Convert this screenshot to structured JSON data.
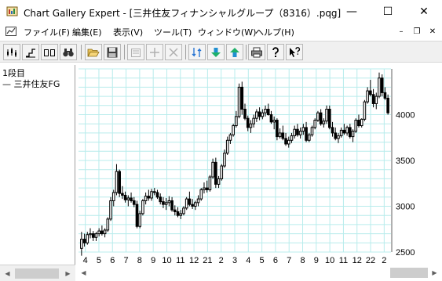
{
  "window": {
    "title": "Chart Gallery Expert - [三井住友フィナンシャルグループ（8316）.pqg]",
    "minimize_glyph": "—",
    "maximize_glyph": "☐",
    "close_glyph": "✕"
  },
  "menu": {
    "items": [
      "ファイル(F)",
      "編集(E)",
      "表示(V)",
      "ツール(T)",
      "ウィンドウ(W)",
      "ヘルプ(H)"
    ],
    "mdi_minimize_glyph": "–",
    "mdi_restore_glyph": "❐",
    "mdi_close_glyph": "✕"
  },
  "toolbar": {
    "buttons": [
      {
        "name": "candlestick-chart-button",
        "icon": "candlestick-icon",
        "enabled": true
      },
      {
        "name": "step-chart-button",
        "icon": "step-chart-icon",
        "enabled": true
      },
      {
        "name": "two-pane-button",
        "icon": "two-pane-icon",
        "enabled": true
      },
      {
        "name": "find-button",
        "icon": "binoculars-icon",
        "enabled": true
      },
      {
        "name": "open-button",
        "icon": "folder-open-icon",
        "enabled": true
      },
      {
        "name": "save-button",
        "icon": "floppy-disk-icon",
        "enabled": true
      },
      {
        "name": "properties-button",
        "icon": "properties-icon",
        "enabled": false
      },
      {
        "name": "add-button",
        "icon": "plus-icon",
        "enabled": false
      },
      {
        "name": "delete-button",
        "icon": "x-icon",
        "enabled": false
      },
      {
        "name": "sort-button",
        "icon": "sort-icon",
        "enabled": true
      },
      {
        "name": "move-down-button",
        "icon": "arrow-down-icon",
        "enabled": true
      },
      {
        "name": "move-up-button",
        "icon": "arrow-up-icon",
        "enabled": true
      },
      {
        "name": "print-button",
        "icon": "printer-icon",
        "enabled": true
      },
      {
        "name": "help-button",
        "icon": "help-question-icon",
        "enabled": true
      },
      {
        "name": "context-help-button",
        "icon": "context-help-icon",
        "enabled": true
      }
    ]
  },
  "legend": {
    "row_label": "1段目",
    "series_label": "— 三井住友FG"
  },
  "colors": {
    "grid": "#b8ecec",
    "candle": "#000000",
    "scroll_bg": "#f0f0f0"
  },
  "chart_data": {
    "type": "candlestick",
    "title": "",
    "series_name": "三井住友FG",
    "ylim": [
      2500,
      4500
    ],
    "y_ticks": [
      2500,
      3000,
      3500,
      4000
    ],
    "y_tick_labels": [
      "2500",
      "3000",
      "3500",
      "4000"
    ],
    "x_tick_labels": [
      "4",
      "5",
      "6",
      "7",
      "8",
      "9",
      "10",
      "11",
      "12",
      "21",
      "2",
      "3",
      "4",
      "5",
      "6",
      "7",
      "8",
      "9",
      "10",
      "11",
      "12",
      "22",
      "2"
    ],
    "grid": true,
    "candles": [
      [
        2540,
        2720,
        2460,
        2640
      ],
      [
        2640,
        2700,
        2560,
        2600
      ],
      [
        2600,
        2720,
        2580,
        2690
      ],
      [
        2690,
        2760,
        2650,
        2700
      ],
      [
        2700,
        2730,
        2620,
        2660
      ],
      [
        2660,
        2720,
        2620,
        2700
      ],
      [
        2700,
        2760,
        2670,
        2730
      ],
      [
        2730,
        2790,
        2680,
        2700
      ],
      [
        2700,
        2760,
        2660,
        2740
      ],
      [
        2740,
        2880,
        2720,
        2860
      ],
      [
        2860,
        3100,
        2840,
        3060
      ],
      [
        3060,
        3180,
        3000,
        3150
      ],
      [
        3150,
        3460,
        3120,
        3380
      ],
      [
        3380,
        3400,
        3100,
        3140
      ],
      [
        3140,
        3220,
        3080,
        3120
      ],
      [
        3120,
        3160,
        3040,
        3070
      ],
      [
        3070,
        3120,
        3000,
        3090
      ],
      [
        3090,
        3150,
        3040,
        3060
      ],
      [
        3060,
        3100,
        2990,
        3020
      ],
      [
        3020,
        3060,
        2760,
        2780
      ],
      [
        2780,
        2950,
        2760,
        2920
      ],
      [
        2920,
        3080,
        2900,
        3060
      ],
      [
        3060,
        3150,
        3020,
        3110
      ],
      [
        3110,
        3180,
        3060,
        3090
      ],
      [
        3090,
        3190,
        3060,
        3160
      ],
      [
        3160,
        3200,
        3120,
        3150
      ],
      [
        3150,
        3180,
        3080,
        3100
      ],
      [
        3100,
        3140,
        3020,
        3050
      ],
      [
        3050,
        3100,
        2980,
        3020
      ],
      [
        3020,
        3090,
        2960,
        3040
      ],
      [
        3040,
        3110,
        3000,
        3060
      ],
      [
        3060,
        3100,
        2940,
        2960
      ],
      [
        2960,
        3010,
        2900,
        2940
      ],
      [
        2940,
        2990,
        2880,
        2900
      ],
      [
        2900,
        2960,
        2860,
        2920
      ],
      [
        2920,
        3000,
        2900,
        2980
      ],
      [
        2980,
        3100,
        2960,
        3080
      ],
      [
        3080,
        3160,
        3000,
        3020
      ],
      [
        3020,
        3080,
        2970,
        3000
      ],
      [
        3000,
        3060,
        2960,
        3040
      ],
      [
        3040,
        3120,
        3000,
        3080
      ],
      [
        3080,
        3200,
        3060,
        3180
      ],
      [
        3180,
        3260,
        3140,
        3200
      ],
      [
        3200,
        3280,
        3150,
        3180
      ],
      [
        3180,
        3340,
        3160,
        3320
      ],
      [
        3320,
        3520,
        3300,
        3480
      ],
      [
        3480,
        3530,
        3200,
        3240
      ],
      [
        3240,
        3330,
        3200,
        3300
      ],
      [
        3300,
        3460,
        3280,
        3440
      ],
      [
        3440,
        3620,
        3420,
        3580
      ],
      [
        3580,
        3760,
        3560,
        3720
      ],
      [
        3720,
        3800,
        3680,
        3780
      ],
      [
        3780,
        3900,
        3760,
        3880
      ],
      [
        3880,
        4040,
        3860,
        3980
      ],
      [
        3980,
        4340,
        3960,
        4300
      ],
      [
        4300,
        4360,
        4000,
        4060
      ],
      [
        4060,
        4120,
        3940,
        3960
      ],
      [
        3960,
        3990,
        3820,
        3860
      ],
      [
        3860,
        3940,
        3800,
        3900
      ],
      [
        3900,
        4000,
        3860,
        3960
      ],
      [
        3960,
        4060,
        3920,
        4030
      ],
      [
        4030,
        4080,
        3940,
        3980
      ],
      [
        3980,
        4060,
        3950,
        4020
      ],
      [
        4020,
        4100,
        3980,
        4060
      ],
      [
        4060,
        4120,
        3990,
        4000
      ],
      [
        4000,
        4040,
        3900,
        3920
      ],
      [
        3920,
        3980,
        3840,
        3940
      ],
      [
        3940,
        3960,
        3720,
        3760
      ],
      [
        3760,
        3850,
        3740,
        3800
      ],
      [
        3800,
        3880,
        3720,
        3740
      ],
      [
        3740,
        3800,
        3660,
        3680
      ],
      [
        3680,
        3760,
        3640,
        3720
      ],
      [
        3720,
        3800,
        3690,
        3770
      ],
      [
        3770,
        3880,
        3740,
        3840
      ],
      [
        3840,
        3900,
        3760,
        3780
      ],
      [
        3780,
        3860,
        3740,
        3820
      ],
      [
        3820,
        3900,
        3780,
        3860
      ],
      [
        3860,
        3920,
        3700,
        3720
      ],
      [
        3720,
        3800,
        3700,
        3780
      ],
      [
        3780,
        3880,
        3760,
        3860
      ],
      [
        3860,
        3960,
        3840,
        3940
      ],
      [
        3940,
        4040,
        3920,
        4020
      ],
      [
        4020,
        4060,
        3880,
        3900
      ],
      [
        3900,
        3960,
        3860,
        3930
      ],
      [
        3930,
        4100,
        3900,
        4060
      ],
      [
        4060,
        4100,
        3840,
        3860
      ],
      [
        3860,
        3920,
        3760,
        3800
      ],
      [
        3800,
        3860,
        3720,
        3740
      ],
      [
        3740,
        3800,
        3690,
        3770
      ],
      [
        3770,
        3860,
        3750,
        3830
      ],
      [
        3830,
        3900,
        3780,
        3800
      ],
      [
        3800,
        3880,
        3770,
        3860
      ],
      [
        3860,
        3900,
        3740,
        3760
      ],
      [
        3760,
        3840,
        3700,
        3820
      ],
      [
        3820,
        3960,
        3800,
        3940
      ],
      [
        3940,
        4000,
        3860,
        3880
      ],
      [
        3880,
        3960,
        3860,
        3950
      ],
      [
        3950,
        4160,
        3930,
        4140
      ],
      [
        4140,
        4300,
        4120,
        4260
      ],
      [
        4260,
        4380,
        4200,
        4220
      ],
      [
        4220,
        4280,
        4080,
        4120
      ],
      [
        4120,
        4240,
        4060,
        4200
      ],
      [
        4200,
        4460,
        4180,
        4400
      ],
      [
        4400,
        4440,
        4200,
        4240
      ],
      [
        4240,
        4300,
        4160,
        4180
      ],
      [
        4180,
        4220,
        4000,
        4020
      ]
    ]
  }
}
